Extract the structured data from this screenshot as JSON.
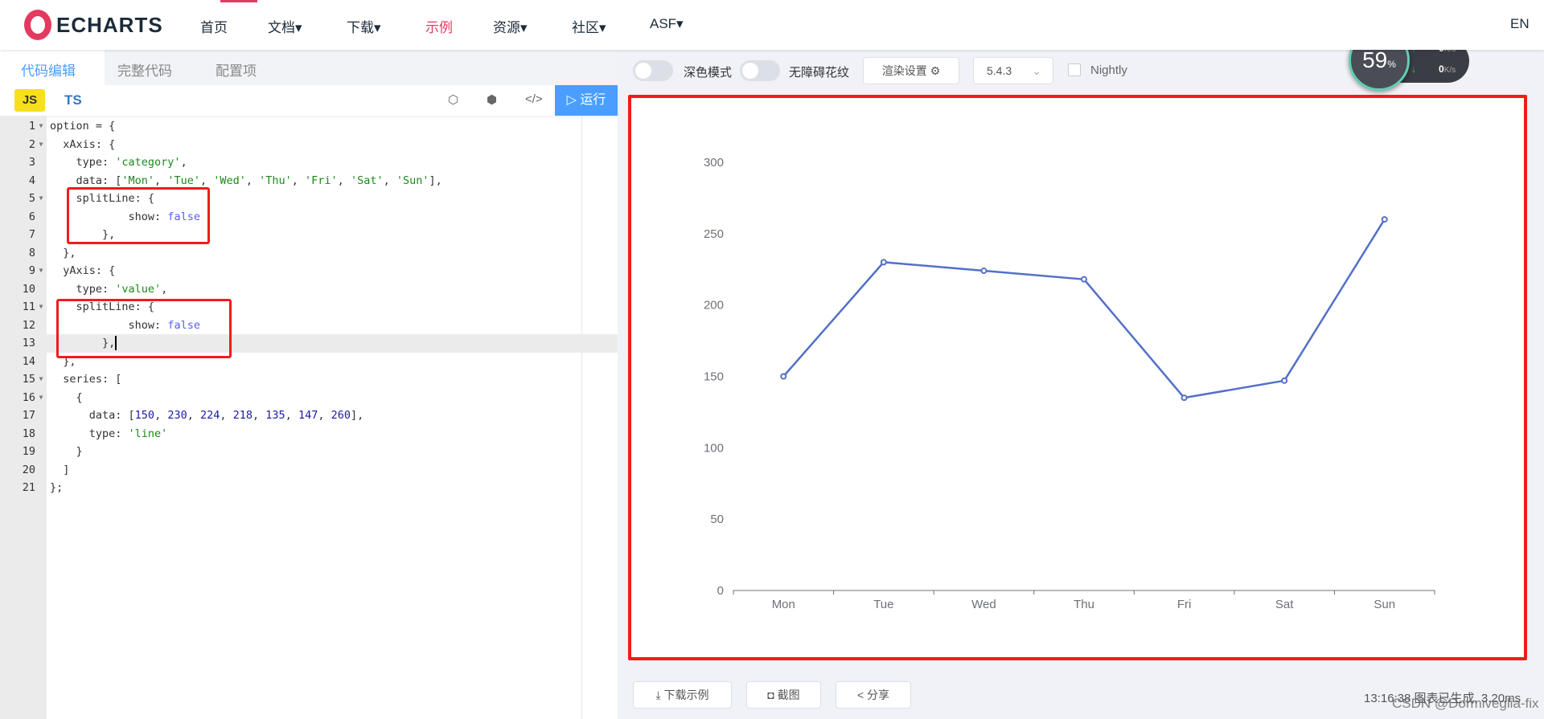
{
  "nav": {
    "brand": "ECHARTS",
    "items": [
      "首页",
      "文档▾",
      "下载▾",
      "示例",
      "资源▾",
      "社区▾",
      "ASF▾"
    ],
    "active_index": 3,
    "lang": "EN"
  },
  "editor": {
    "tabs": [
      "代码编辑",
      "完整代码",
      "配置项"
    ],
    "langs": {
      "js": "JS",
      "ts": "TS"
    },
    "run_label": "运行",
    "icons": [
      "codepen-icon",
      "codesandbox-icon",
      "embed-code-icon"
    ],
    "current_line": 13,
    "lines": [
      [
        [
          "option = {",
          ""
        ]
      ],
      [
        [
          "  xAxis: {",
          ""
        ]
      ],
      [
        [
          "    type: ",
          ""
        ],
        [
          "'category'",
          "s"
        ],
        [
          ",",
          ""
        ]
      ],
      [
        [
          "    data: [",
          ""
        ],
        [
          "'Mon'",
          "s"
        ],
        [
          ", ",
          ""
        ],
        [
          "'Tue'",
          "s"
        ],
        [
          ", ",
          ""
        ],
        [
          "'Wed'",
          "s"
        ],
        [
          ", ",
          ""
        ],
        [
          "'Thu'",
          "s"
        ],
        [
          ", ",
          ""
        ],
        [
          "'Fri'",
          "s"
        ],
        [
          ", ",
          ""
        ],
        [
          "'Sat'",
          "s"
        ],
        [
          ", ",
          ""
        ],
        [
          "'Sun'",
          "s"
        ],
        [
          "],",
          ""
        ]
      ],
      [
        [
          "    splitLine: {",
          ""
        ]
      ],
      [
        [
          "            show: ",
          ""
        ],
        [
          "false",
          "k"
        ]
      ],
      [
        [
          "        },",
          ""
        ]
      ],
      [
        [
          "  },",
          ""
        ]
      ],
      [
        [
          "  yAxis: {",
          ""
        ]
      ],
      [
        [
          "    type: ",
          ""
        ],
        [
          "'value'",
          "s"
        ],
        [
          ",",
          ""
        ]
      ],
      [
        [
          "    splitLine: {",
          ""
        ]
      ],
      [
        [
          "            show: ",
          ""
        ],
        [
          "false",
          "k"
        ]
      ],
      [
        [
          "        },",
          ""
        ]
      ],
      [
        [
          "  },",
          ""
        ]
      ],
      [
        [
          "  series: [",
          ""
        ]
      ],
      [
        [
          "    {",
          ""
        ]
      ],
      [
        [
          "      data: [",
          ""
        ],
        [
          "150",
          "n"
        ],
        [
          ", ",
          ""
        ],
        [
          "230",
          "n"
        ],
        [
          ", ",
          ""
        ],
        [
          "224",
          "n"
        ],
        [
          ", ",
          ""
        ],
        [
          "218",
          "n"
        ],
        [
          ", ",
          ""
        ],
        [
          "135",
          "n"
        ],
        [
          ", ",
          ""
        ],
        [
          "147",
          "n"
        ],
        [
          ", ",
          ""
        ],
        [
          "260",
          "n"
        ],
        [
          "],",
          ""
        ]
      ],
      [
        [
          "      type: ",
          ""
        ],
        [
          "'line'",
          "s"
        ]
      ],
      [
        [
          "    }",
          ""
        ]
      ],
      [
        [
          "  ]",
          ""
        ]
      ],
      [
        [
          "};",
          ""
        ]
      ]
    ],
    "foldable_lines": [
      1,
      2,
      5,
      9,
      11,
      15,
      16
    ]
  },
  "toolbar": {
    "dark_mode": "深色模式",
    "aria": "无障碍花纹",
    "render_settings": "渲染设置",
    "version": "5.4.3",
    "nightly": "Nightly",
    "dark_mode_on": false,
    "aria_on": false,
    "nightly_checked": false
  },
  "stats": {
    "percent": "59",
    "percent_unit": "%",
    "up": "0",
    "down": "0",
    "unit": "K/s"
  },
  "chart_data": {
    "type": "line",
    "categories": [
      "Mon",
      "Tue",
      "Wed",
      "Thu",
      "Fri",
      "Sat",
      "Sun"
    ],
    "values": [
      150,
      230,
      224,
      218,
      135,
      147,
      260
    ],
    "ylim": [
      0,
      300
    ],
    "yticks": [
      0,
      50,
      100,
      150,
      200,
      250,
      300
    ],
    "grid": false,
    "color": "#5470c6"
  },
  "footer": {
    "download": "下载示例",
    "screenshot": "截图",
    "share": "分享",
    "status": "13:16:38  图表已生成, 3.20ms",
    "watermark": "CSDN @Dormiveglia-fix"
  },
  "colors": {
    "accent": "#e43961",
    "run": "#4a9eff",
    "highlight_box": "#f01c1c"
  }
}
